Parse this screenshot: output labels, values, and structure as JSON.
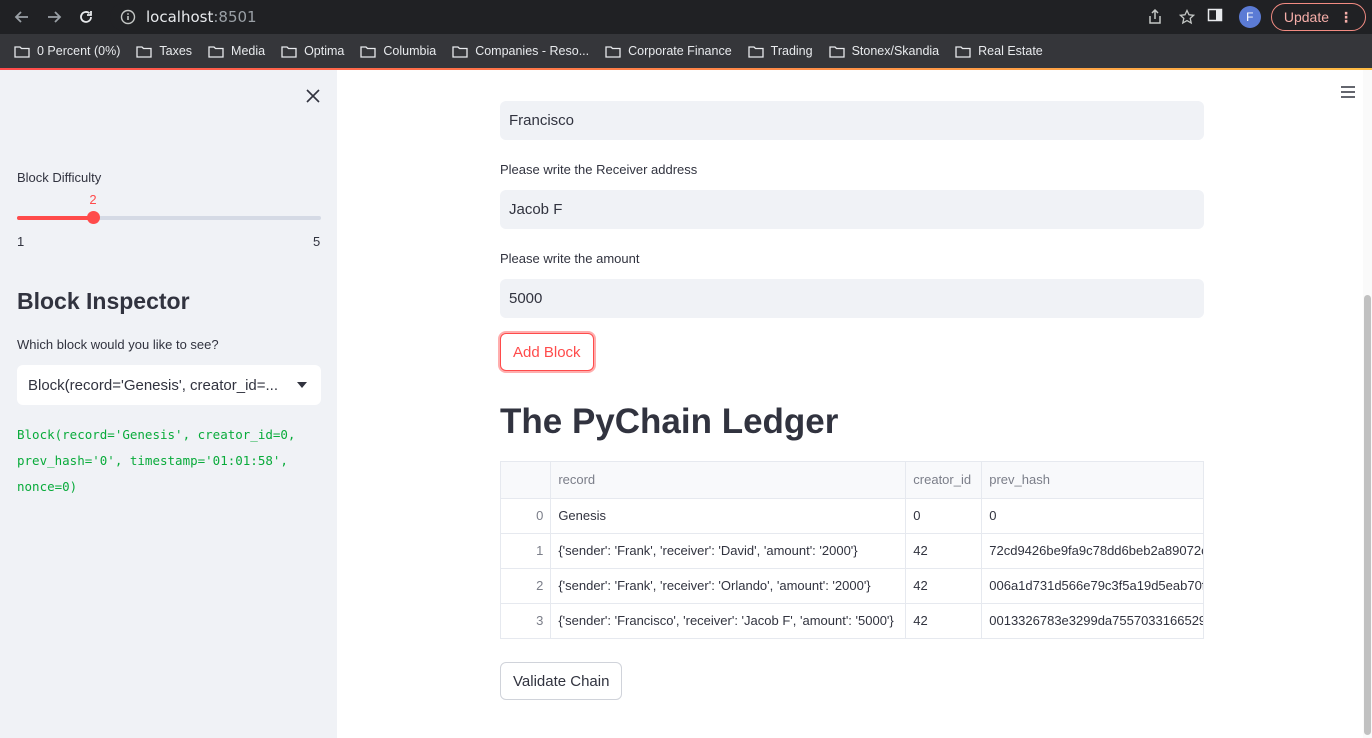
{
  "browser": {
    "url_host": "localhost",
    "url_port": ":8501",
    "profile_initial": "F",
    "update_label": "Update",
    "bookmarks": [
      "0 Percent (0%)",
      "Taxes",
      "Media",
      "Optima",
      "Columbia",
      "Companies - Reso...",
      "Corporate Finance",
      "Trading",
      "Stonex/Skandia",
      "Real Estate"
    ]
  },
  "sidebar": {
    "slider": {
      "label": "Block Difficulty",
      "value": 2,
      "value_text": "2",
      "min": 1,
      "max": 5,
      "min_text": "1",
      "max_text": "5"
    },
    "inspector_title": "Block Inspector",
    "select_label": "Which block would you like to see?",
    "select_value": "Block(record='Genesis', creator_id=...",
    "code_output": "Block(record='Genesis', creator_id=0,\nprev_hash='0', timestamp='01:01:58',\nnonce=0)"
  },
  "main": {
    "sender_value": "Francisco",
    "receiver_label": "Please write the Receiver address",
    "receiver_value": "Jacob F",
    "amount_label": "Please write the amount",
    "amount_value": "5000",
    "add_block_label": "Add Block",
    "ledger_title": "The PyChain Ledger",
    "table": {
      "columns": [
        "",
        "record",
        "creator_id",
        "prev_hash"
      ],
      "rows": [
        [
          "0",
          "Genesis",
          "0",
          "0"
        ],
        [
          "1",
          "{'sender': 'Frank', 'receiver': 'David', 'amount': '2000'}",
          "42",
          "72cd9426be9fa9c78dd6beb2a89072c"
        ],
        [
          "2",
          "{'sender': 'Frank', 'receiver': 'Orlando', 'amount': '2000'}",
          "42",
          "006a1d731d566e79c3f5a19d5eab70f"
        ],
        [
          "3",
          "{'sender': 'Francisco', 'receiver': 'Jacob F', 'amount': '5000'}",
          "42",
          "0013326783e3299da75570331665298"
        ]
      ]
    },
    "validate_label": "Validate Chain"
  },
  "colors": {
    "accent": "#ff4b4b",
    "sidebar_bg": "#f0f2f6",
    "code_green": "#09ab3b"
  }
}
